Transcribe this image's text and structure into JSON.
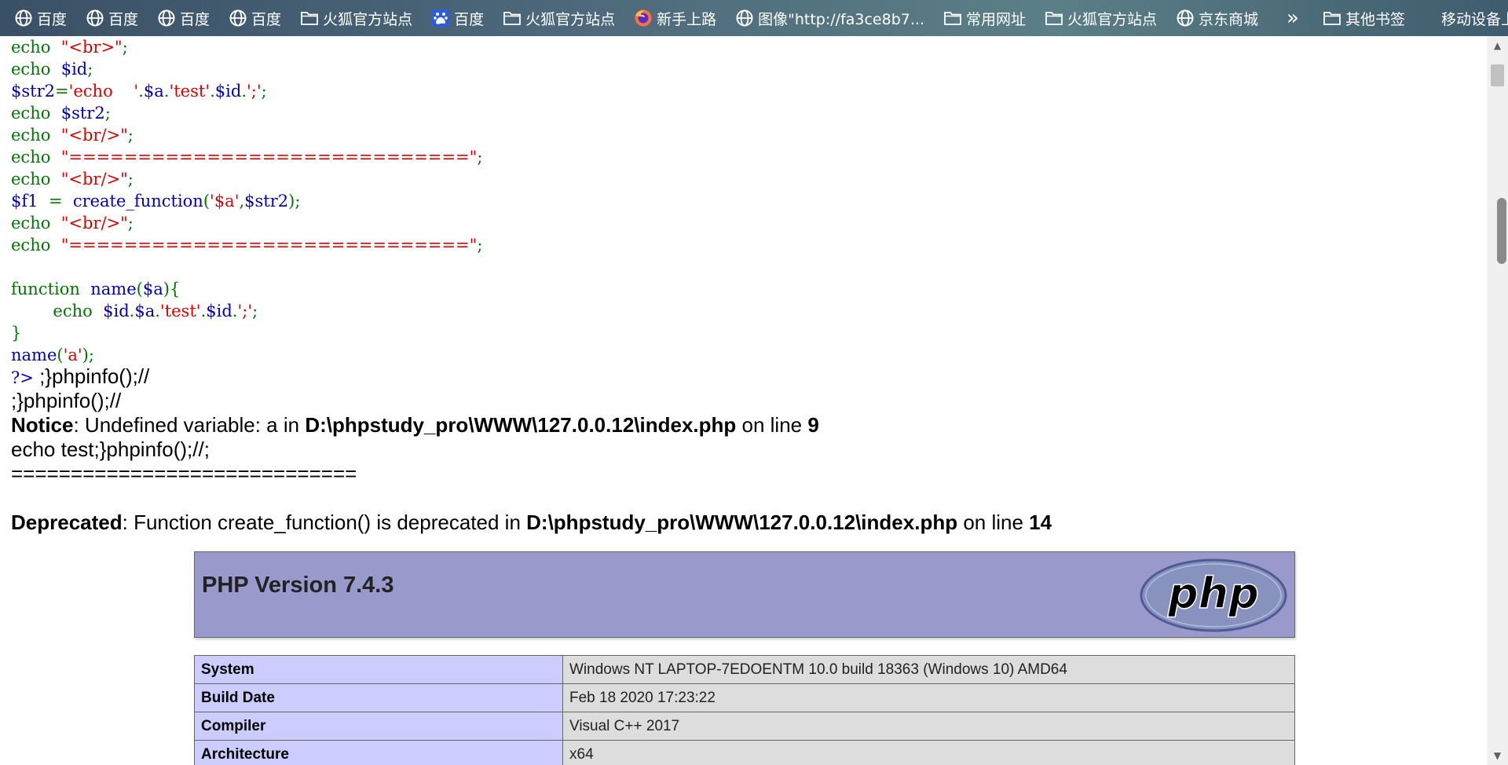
{
  "bookmarks": {
    "items": [
      {
        "label": "百度",
        "icon": "globe-icon"
      },
      {
        "label": "百度",
        "icon": "globe-icon"
      },
      {
        "label": "百度",
        "icon": "globe-icon"
      },
      {
        "label": "百度",
        "icon": "globe-icon"
      },
      {
        "label": "火狐官方站点",
        "icon": "folder-icon"
      },
      {
        "label": "百度",
        "icon": "baidu-paw-icon"
      },
      {
        "label": "火狐官方站点",
        "icon": "folder-icon"
      },
      {
        "label": "新手上路",
        "icon": "firefox-icon"
      },
      {
        "label": "图像\"http://fa3ce8b7...",
        "icon": "globe-icon"
      },
      {
        "label": "常用网址",
        "icon": "folder-icon"
      },
      {
        "label": "火狐官方站点",
        "icon": "folder-icon"
      },
      {
        "label": "京东商城",
        "icon": "globe-icon"
      }
    ],
    "overflow": "»",
    "other": {
      "label": "其他书签",
      "icon": "folder-icon"
    },
    "mobile": {
      "label": "移动设备上的书签"
    }
  },
  "code_lines": [
    [
      {
        "t": "echo  ",
        "c": "kw"
      },
      {
        "t": "\"<br>\"",
        "c": "str"
      },
      {
        "t": ";",
        "c": "kw"
      }
    ],
    [
      {
        "t": "echo  ",
        "c": "kw"
      },
      {
        "t": "$id",
        "c": "var"
      },
      {
        "t": ";",
        "c": "kw"
      }
    ],
    [
      {
        "t": "$str2",
        "c": "var"
      },
      {
        "t": "=",
        "c": "kw"
      },
      {
        "t": "'echo    '",
        "c": "str"
      },
      {
        "t": ".",
        "c": "kw"
      },
      {
        "t": "$a",
        "c": "var"
      },
      {
        "t": ".",
        "c": "kw"
      },
      {
        "t": "'test'",
        "c": "str"
      },
      {
        "t": ".",
        "c": "kw"
      },
      {
        "t": "$id",
        "c": "var"
      },
      {
        "t": ".",
        "c": "kw"
      },
      {
        "t": "';'",
        "c": "str"
      },
      {
        "t": ";",
        "c": "kw"
      }
    ],
    [
      {
        "t": "echo  ",
        "c": "kw"
      },
      {
        "t": "$str2",
        "c": "var"
      },
      {
        "t": ";",
        "c": "kw"
      }
    ],
    [
      {
        "t": "echo  ",
        "c": "kw"
      },
      {
        "t": "\"<br/>\"",
        "c": "str"
      },
      {
        "t": ";",
        "c": "kw"
      }
    ],
    [
      {
        "t": "echo  ",
        "c": "kw"
      },
      {
        "t": "\"=============================\"",
        "c": "str"
      },
      {
        "t": ";",
        "c": "kw"
      }
    ],
    [
      {
        "t": "echo  ",
        "c": "kw"
      },
      {
        "t": "\"<br/>\"",
        "c": "str"
      },
      {
        "t": ";",
        "c": "kw"
      }
    ],
    [
      {
        "t": "$f1  ",
        "c": "var"
      },
      {
        "t": "=  ",
        "c": "kw"
      },
      {
        "t": "create_function",
        "c": "var"
      },
      {
        "t": "(",
        "c": "kw"
      },
      {
        "t": "'$a'",
        "c": "str"
      },
      {
        "t": ",",
        "c": "kw"
      },
      {
        "t": "$str2",
        "c": "var"
      },
      {
        "t": ");",
        "c": "kw"
      }
    ],
    [
      {
        "t": "echo  ",
        "c": "kw"
      },
      {
        "t": "\"<br/>\"",
        "c": "str"
      },
      {
        "t": ";",
        "c": "kw"
      }
    ],
    [
      {
        "t": "echo  ",
        "c": "kw"
      },
      {
        "t": "\"=============================\"",
        "c": "str"
      },
      {
        "t": ";",
        "c": "kw"
      }
    ],
    [],
    [
      {
        "t": "function  ",
        "c": "kw"
      },
      {
        "t": "name",
        "c": "var"
      },
      {
        "t": "(",
        "c": "kw"
      },
      {
        "t": "$a",
        "c": "var"
      },
      {
        "t": "){",
        "c": "kw"
      }
    ],
    [
      {
        "t": "        echo  ",
        "c": "kw"
      },
      {
        "t": "$id",
        "c": "var"
      },
      {
        "t": ".",
        "c": "kw"
      },
      {
        "t": "$a",
        "c": "var"
      },
      {
        "t": ".",
        "c": "kw"
      },
      {
        "t": "'test'",
        "c": "str"
      },
      {
        "t": ".",
        "c": "kw"
      },
      {
        "t": "$id",
        "c": "var"
      },
      {
        "t": ".",
        "c": "kw"
      },
      {
        "t": "';'",
        "c": "str"
      },
      {
        "t": ";",
        "c": "kw"
      }
    ],
    [
      {
        "t": "}",
        "c": "kw"
      }
    ],
    [
      {
        "t": "name",
        "c": "var"
      },
      {
        "t": "(",
        "c": "kw"
      },
      {
        "t": "'a'",
        "c": "str"
      },
      {
        "t": ");",
        "c": "kw"
      }
    ],
    [
      {
        "t": "?>",
        "c": "var"
      }
    ]
  ],
  "output": {
    "line1_tail": " ;}phpinfo();//",
    "line2": ";}phpinfo();//",
    "notice": {
      "label": "Notice",
      "message": ": Undefined variable: a in ",
      "file": "D:\\phpstudy_pro\\WWW\\127.0.0.12\\index.php",
      "on_line": " on line ",
      "line": "9"
    },
    "echo_line": "echo test;}phpinfo();//;",
    "separator": "=============================",
    "deprecated": {
      "label": "Deprecated",
      "message": ": Function create_function() is deprecated in ",
      "file": "D:\\phpstudy_pro\\WWW\\127.0.0.12\\index.php",
      "on_line": " on line ",
      "line": "14"
    }
  },
  "phpinfo": {
    "version": "PHP Version 7.4.3",
    "logo_text": "php",
    "rows": [
      {
        "key": "System",
        "value": "Windows NT LAPTOP-7EDOENTM 10.0 build 18363 (Windows 10) AMD64"
      },
      {
        "key": "Build Date",
        "value": "Feb 18 2020 17:23:22"
      },
      {
        "key": "Compiler",
        "value": "Visual C++ 2017"
      },
      {
        "key": "Architecture",
        "value": "x64"
      }
    ]
  },
  "colors": {
    "keyword": "#007700",
    "variable": "#0000bb",
    "string": "#dd0000",
    "php_header_bg": "#9999cc",
    "table_key_bg": "#ccccff",
    "table_value_bg": "#dddddd"
  },
  "scrollbar": {
    "up_icon": "chevron-up-icon",
    "down_icon": "chevron-down-icon"
  }
}
